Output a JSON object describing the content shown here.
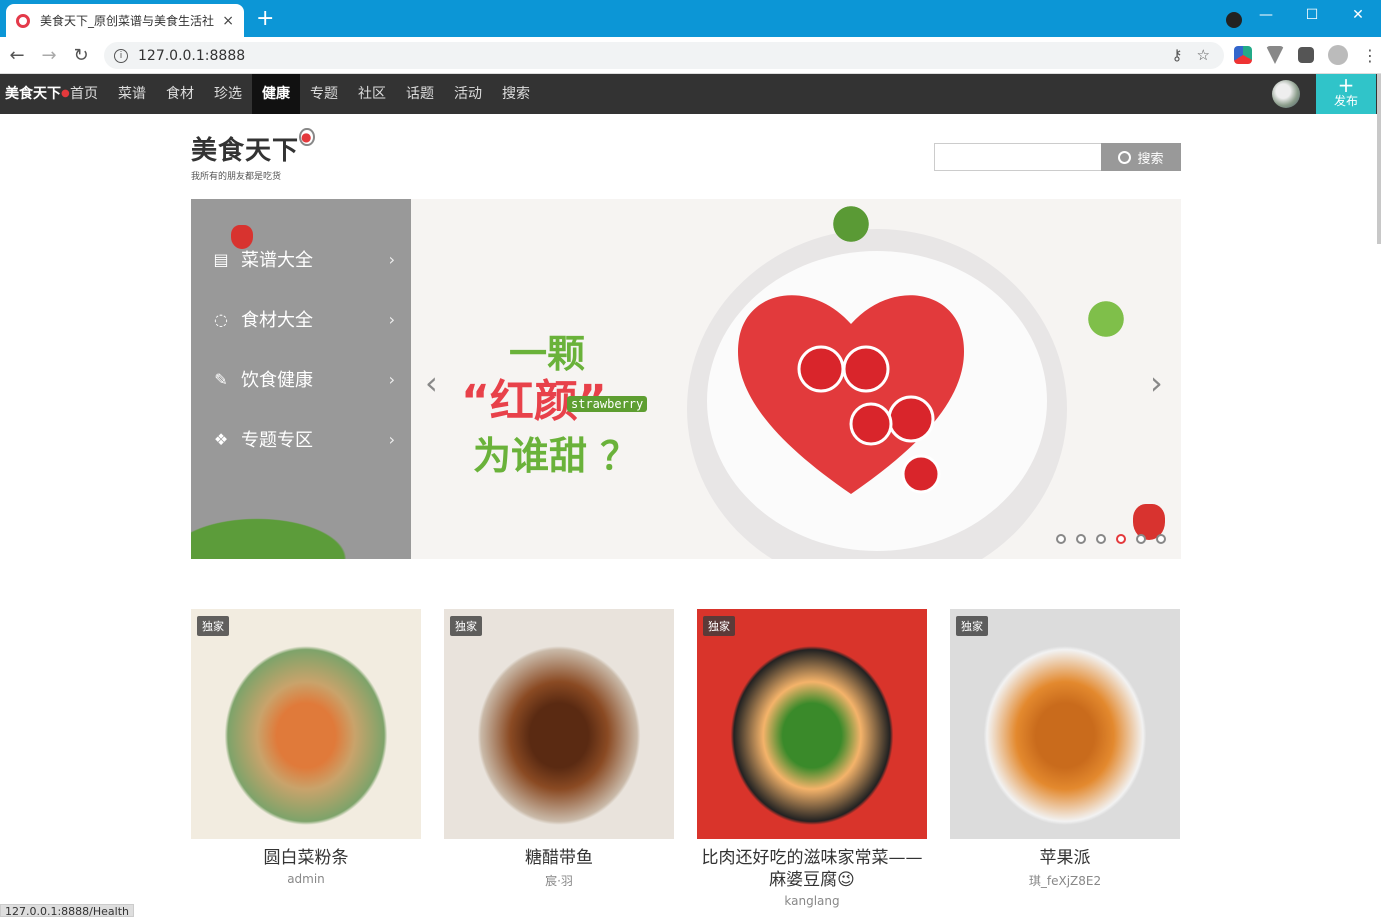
{
  "browser": {
    "tab_title": "美食天下_原创菜谱与美食生活社",
    "tab_close": "×",
    "new_tab": "+",
    "url": "127.0.0.1:8888",
    "status_url": "127.0.0.1:8888/Health",
    "accent_color": "#0c96d6"
  },
  "nav": {
    "logo": "美食天下",
    "logo_dot": "●",
    "links": [
      "首页",
      "菜谱",
      "食材",
      "珍选",
      "健康",
      "专题",
      "社区",
      "话题",
      "活动",
      "搜索"
    ],
    "active_index": 4,
    "publish_plus": "+",
    "publish_label": "发布"
  },
  "header": {
    "brand": "美食天下",
    "brand_dot": "●",
    "slogan": "我所有的朋友都是吃货",
    "search_placeholder": "",
    "search_button": "搜索"
  },
  "categories": [
    {
      "label": "菜谱大全",
      "icon": "recipe-icon"
    },
    {
      "label": "食材大全",
      "icon": "ingredient-icon"
    },
    {
      "label": "饮食健康",
      "icon": "health-icon"
    },
    {
      "label": "专题专区",
      "icon": "topic-icon"
    }
  ],
  "banner": {
    "line1": "一颗",
    "line2": "“红颜”",
    "tag": "strawberry",
    "line3": "为谁甜 ？",
    "slide_count": 6,
    "active_slide": 3
  },
  "cards": [
    {
      "badge": "独家",
      "title": "圆白菜粉条",
      "author": "admin",
      "colors": [
        "#f2ece0",
        "#c9a36b",
        "#e07a3a",
        "#7ea36a"
      ]
    },
    {
      "badge": "独家",
      "title": "糖醋带鱼",
      "author": "宸·羽",
      "colors": [
        "#e9e3dc",
        "#8a4a23",
        "#5a2a12",
        "#c9b9a8"
      ]
    },
    {
      "badge": "独家",
      "title": "比肉还好吃的滋味家常菜——麻婆豆腐😉",
      "author": "kanglang",
      "colors": [
        "#d9342b",
        "#f4b36a",
        "#3a8a2a",
        "#222"
      ]
    },
    {
      "badge": "独家",
      "title": "苹果派",
      "author": "琪_feXjZ8E2",
      "colors": [
        "#dcdcdc",
        "#e3892e",
        "#c96b1c",
        "#f2f2f2"
      ]
    }
  ]
}
